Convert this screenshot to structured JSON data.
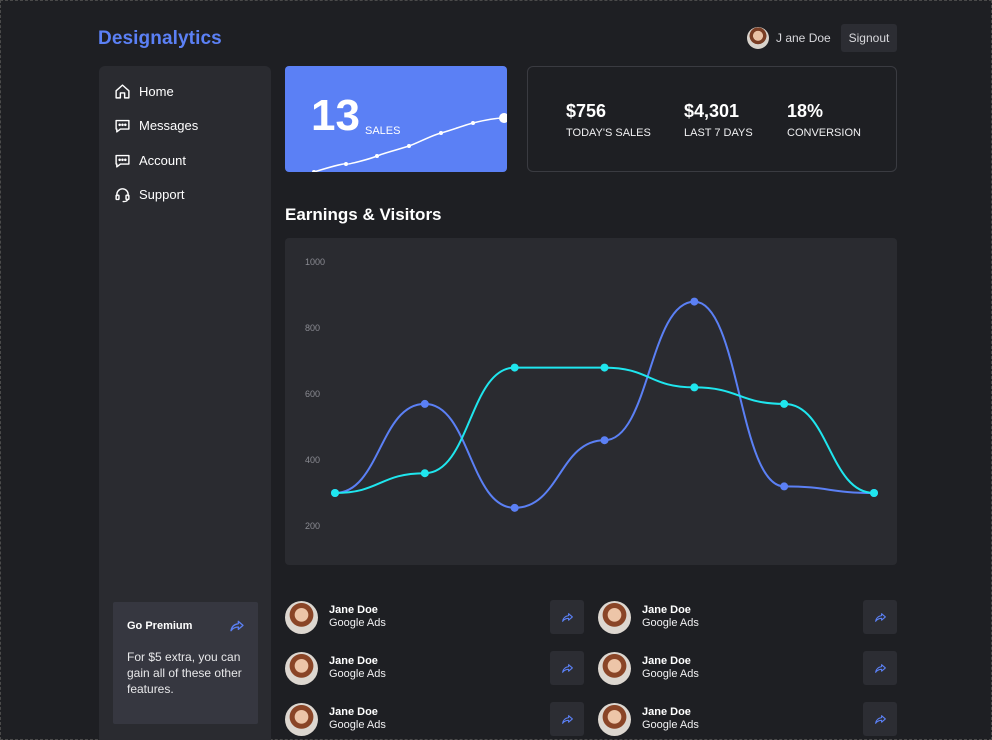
{
  "brand": "Designalytics",
  "header": {
    "user_name": "J ane Doe",
    "signout_label": "Signout"
  },
  "sidebar": {
    "items": [
      {
        "label": "Home",
        "icon": "home-icon"
      },
      {
        "label": "Messages",
        "icon": "chat-icon"
      },
      {
        "label": "Account",
        "icon": "chat-icon"
      },
      {
        "label": "Support",
        "icon": "headset-icon"
      }
    ],
    "premium": {
      "title": "Go Premium",
      "text": "For $5 extra, you can gain all of these other features."
    }
  },
  "sales_card": {
    "value": "13",
    "label": "SALES"
  },
  "stats": [
    {
      "value": "$756",
      "label": "TODAY'S SALES"
    },
    {
      "value": "$4,301",
      "label": "LAST 7 DAYS"
    },
    {
      "value": "18%",
      "label": "CONVERSION"
    }
  ],
  "section_title": "Earnings & Visitors",
  "colors": {
    "accent": "#5b80f5",
    "cyan": "#1fe6ee",
    "bg": "#1e1f23",
    "card": "#2a2b30"
  },
  "chart_data": {
    "type": "line",
    "x": [
      1,
      2,
      3,
      4,
      5,
      6,
      7
    ],
    "series": [
      {
        "values": [
          300,
          570,
          255,
          460,
          880,
          320,
          300
        ],
        "color": "#5b80f5"
      },
      {
        "values": [
          300,
          360,
          680,
          680,
          620,
          570,
          300
        ],
        "color": "#1fe6ee"
      }
    ],
    "yticks": [
      200,
      400,
      600,
      800,
      1000
    ],
    "ylim": [
      200,
      1000
    ],
    "grid": false
  },
  "contacts": [
    {
      "name": "Jane Doe",
      "source": "Google Ads"
    },
    {
      "name": "Jane Doe",
      "source": "Google Ads"
    },
    {
      "name": "Jane Doe",
      "source": "Google Ads"
    },
    {
      "name": "Jane Doe",
      "source": "Google Ads"
    },
    {
      "name": "Jane Doe",
      "source": "Google Ads"
    },
    {
      "name": "Jane Doe",
      "source": "Google Ads"
    }
  ]
}
